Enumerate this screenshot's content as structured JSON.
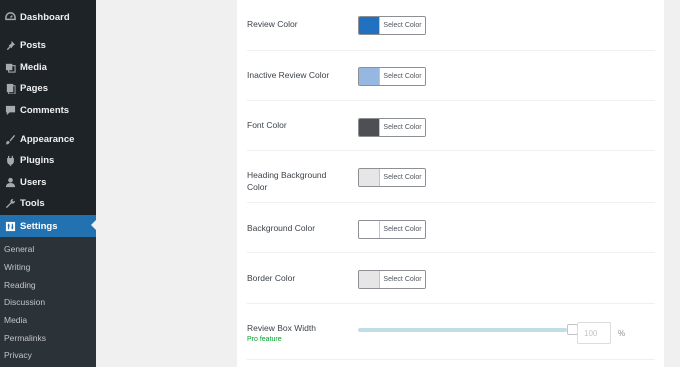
{
  "sidebar": {
    "items": [
      {
        "label": "Dashboard",
        "icon": "dashboard-icon"
      },
      {
        "label": "Posts",
        "icon": "pin-icon"
      },
      {
        "label": "Media",
        "icon": "media-icon"
      },
      {
        "label": "Pages",
        "icon": "page-icon"
      },
      {
        "label": "Comments",
        "icon": "comment-icon"
      },
      {
        "label": "Appearance",
        "icon": "brush-icon"
      },
      {
        "label": "Plugins",
        "icon": "plug-icon"
      },
      {
        "label": "Users",
        "icon": "user-icon"
      },
      {
        "label": "Tools",
        "icon": "wrench-icon"
      },
      {
        "label": "Settings",
        "icon": "settings-icon"
      }
    ],
    "submenu": [
      "General",
      "Writing",
      "Reading",
      "Discussion",
      "Media",
      "Permalinks",
      "Privacy"
    ],
    "active_color": "#2271b1"
  },
  "settings": {
    "select_label": "Select Color",
    "rows": [
      {
        "label": "Review Color",
        "swatch": "#2271c1"
      },
      {
        "label": "Inactive Review Color",
        "swatch": "#96b8e0"
      },
      {
        "label": "Font Color",
        "swatch": "#4d4f52"
      },
      {
        "label": "Heading Background Color",
        "swatch": "#e6e6e6"
      },
      {
        "label": "Background Color",
        "swatch": "#ffffff"
      },
      {
        "label": "Border Color",
        "swatch": "#e6e6e6"
      }
    ],
    "review_box_width": {
      "label": "Review Box Width",
      "pro": "Pro feature",
      "value": "100",
      "unit": "%",
      "level": 1.0
    }
  }
}
